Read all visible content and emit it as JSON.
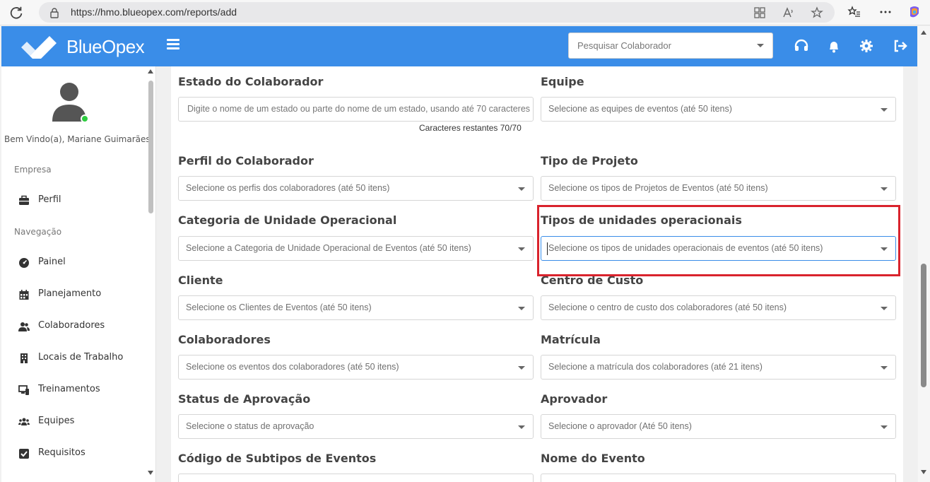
{
  "browser": {
    "url": "https://hmo.blueopex.com/reports/add"
  },
  "header": {
    "brand": "BlueOpex",
    "search_placeholder": "Pesquisar Colaborador"
  },
  "sidebar": {
    "welcome": "Bem Vindo(a), Mariane Guimarães",
    "section_company": "Empresa",
    "section_nav": "Navegação",
    "company_items": [
      {
        "label": "Perfil",
        "icon": "briefcase-icon"
      }
    ],
    "nav_items": [
      {
        "label": "Painel",
        "icon": "dashboard-icon"
      },
      {
        "label": "Planejamento",
        "icon": "calendar-icon"
      },
      {
        "label": "Colaboradores",
        "icon": "users-icon"
      },
      {
        "label": "Locais de Trabalho",
        "icon": "building-icon"
      },
      {
        "label": "Treinamentos",
        "icon": "devices-icon"
      },
      {
        "label": "Equipes",
        "icon": "team-icon"
      },
      {
        "label": "Requisitos",
        "icon": "checkbox-icon"
      }
    ]
  },
  "form": {
    "estado": {
      "label": "Estado do Colaborador",
      "placeholder": "Digite o nome de um estado ou parte do nome de um estado, usando até 70 caracteres",
      "counter": "Caracteres restantes 70/70"
    },
    "equipe": {
      "label": "Equipe",
      "placeholder": "Selecione as equipes de eventos (até 50 itens)"
    },
    "perfil": {
      "label": "Perfil do Colaborador",
      "placeholder": "Selecione os perfis dos colaboradores (até 50 itens)"
    },
    "tipo_projeto": {
      "label": "Tipo de Projeto",
      "placeholder": "Selecione os tipos de Projetos de Eventos (até 50 itens)"
    },
    "categoria_unidade": {
      "label": "Categoria de Unidade Operacional",
      "placeholder": "Selecione a Categoria de Unidade Operacional de Eventos (até 50 itens)"
    },
    "tipos_unidades": {
      "label": "Tipos de unidades operacionais",
      "placeholder": "Selecione os tipos de unidades operacionais de eventos (até 50 itens)"
    },
    "cliente": {
      "label": "Cliente",
      "placeholder": "Selecione os Clientes de Eventos (até 50 itens)"
    },
    "centro_custo": {
      "label": "Centro de Custo",
      "placeholder": "Selecione o centro de custo dos colaboradores (até 50 itens)"
    },
    "colaboradores": {
      "label": "Colaboradores",
      "placeholder": "Selecione os eventos dos colaboradores (até 50 itens)"
    },
    "matricula": {
      "label": "Matrícula",
      "placeholder": "Selecione a matrícula dos colaboradores (até 21 itens)"
    },
    "status_aprovacao": {
      "label": "Status de Aprovação",
      "placeholder": "Selecione o status de aprovação"
    },
    "aprovador": {
      "label": "Aprovador",
      "placeholder": "Selecione o aprovador (Até 50 itens)"
    },
    "codigo_subtipos": {
      "label": "Código de Subtipos de Eventos"
    },
    "nome_evento": {
      "label": "Nome do Evento"
    }
  },
  "colors": {
    "header": "#3a8de8",
    "highlight": "#d9232d",
    "online": "#2ecc40"
  }
}
